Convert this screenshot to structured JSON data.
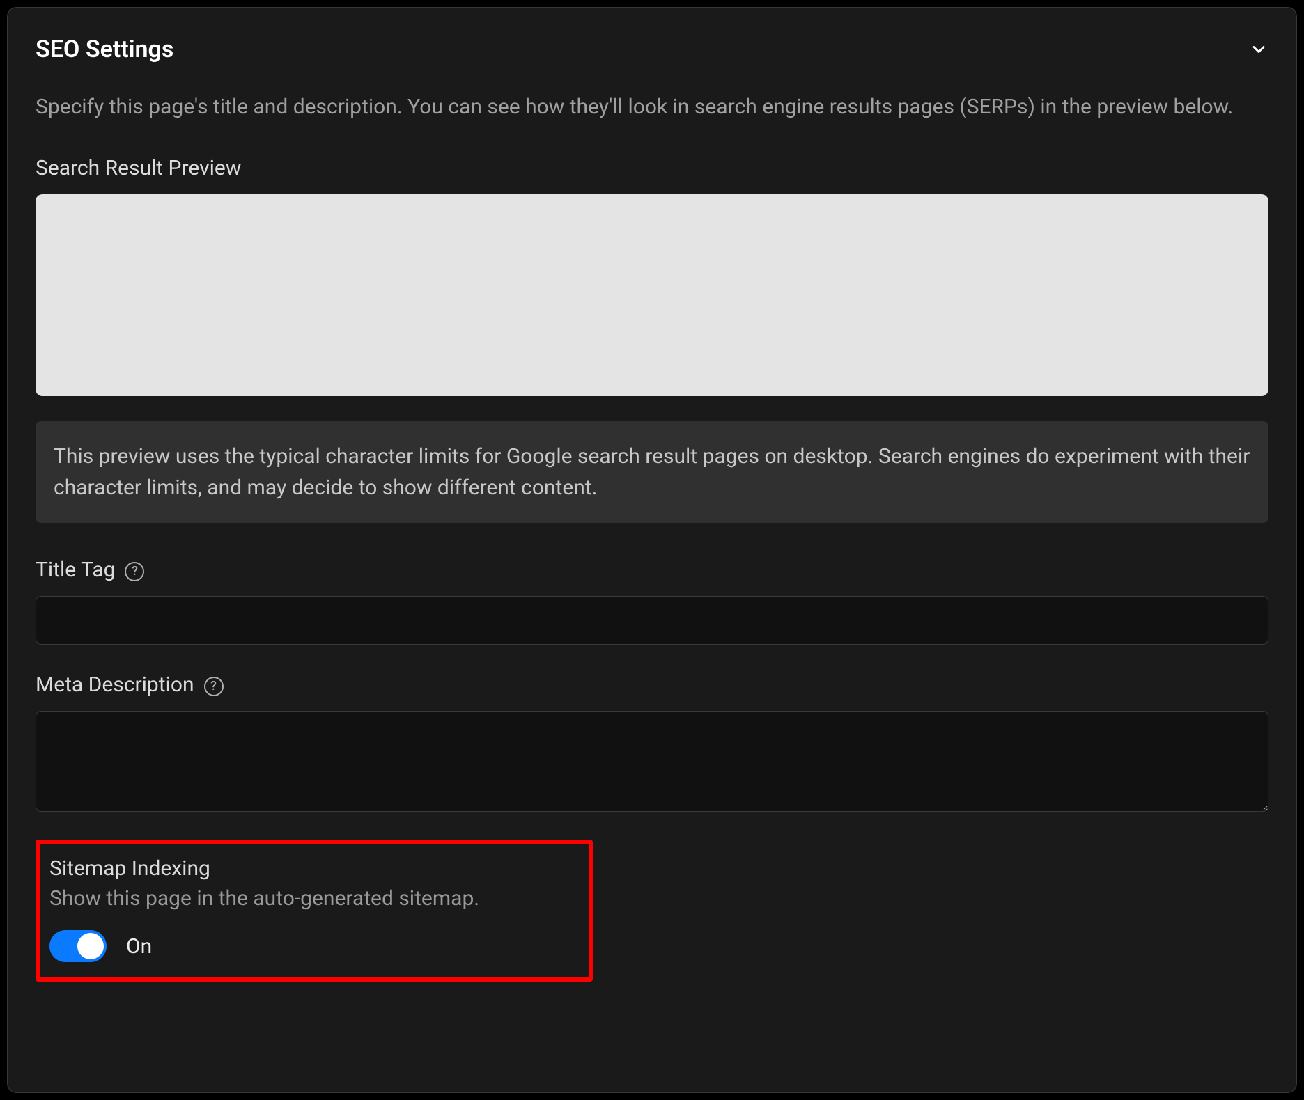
{
  "panel": {
    "title": "SEO Settings",
    "description": "Specify this page's title and description. You can see how they'll look in search engine results pages (SERPs) in the preview below."
  },
  "preview": {
    "label": "Search Result Preview",
    "note": "This preview uses the typical character limits for Google search result pages on desktop. Search engines do experiment with their character limits, and may decide to show different content."
  },
  "titleTag": {
    "label": "Title Tag",
    "value": ""
  },
  "metaDescription": {
    "label": "Meta Description",
    "value": ""
  },
  "sitemap": {
    "title": "Sitemap Indexing",
    "subtitle": "Show this page in the auto-generated sitemap.",
    "state": "On"
  }
}
